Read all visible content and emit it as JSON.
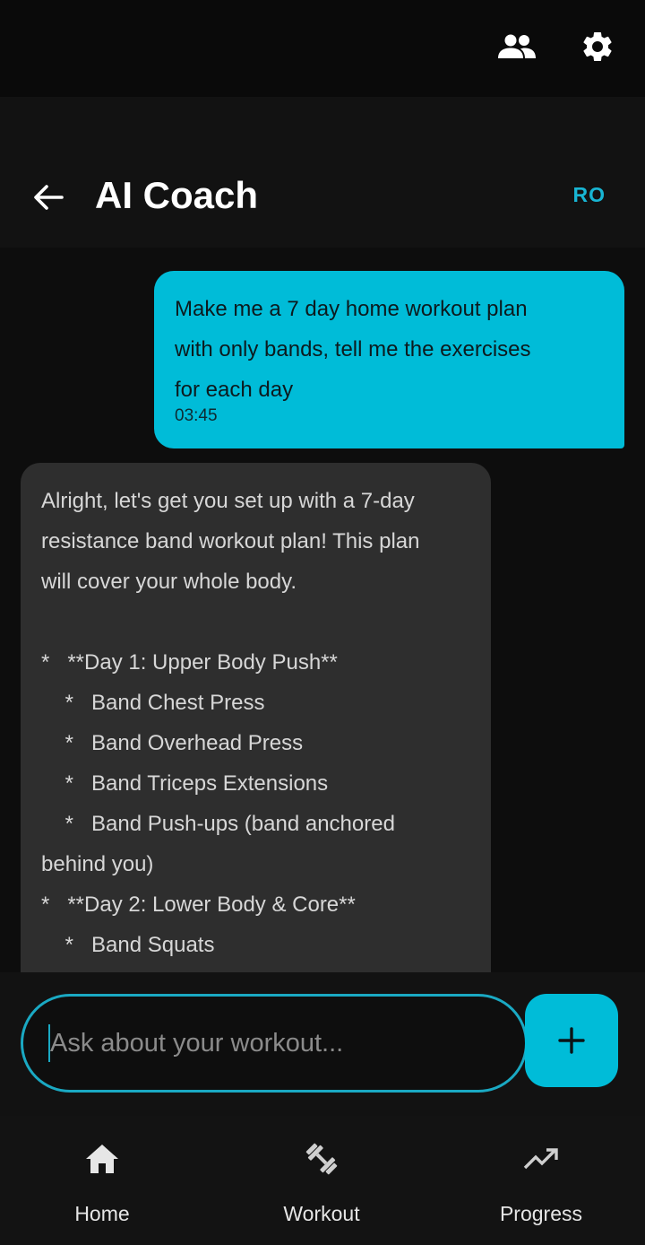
{
  "topbar": {
    "icons": [
      "people-icon",
      "gear-icon"
    ]
  },
  "header": {
    "title": "AI Coach",
    "avatar_initials": "RO"
  },
  "chat": {
    "messages": [
      {
        "role": "user",
        "text": "Make me a 7 day home workout plan\nwith only bands, tell me the exercises\nfor each day",
        "time": "03:45"
      },
      {
        "role": "assistant",
        "text": "Alright, let's get you set up with a 7-day\nresistance band workout plan! This plan\nwill cover your whole body.\n\n*   **Day 1: Upper Body Push**\n    *   Band Chest Press\n    *   Band Overhead Press\n    *   Band Triceps Extensions\n    *   Band Push-ups (band anchored\nbehind you)\n*   **Day 2: Lower Body & Core**\n    *   Band Squats\n    *   Band Glute Bridges"
      }
    ]
  },
  "composer": {
    "placeholder": "Ask about your workout...",
    "value": "",
    "send_icon": "plus-icon"
  },
  "nav": {
    "items": [
      {
        "label": "Home",
        "icon": "home-icon"
      },
      {
        "label": "Workout",
        "icon": "dumbbell-icon"
      },
      {
        "label": "Progress",
        "icon": "trending-up-icon"
      }
    ]
  },
  "colors": {
    "accent": "#00bcd8",
    "background": "#101010",
    "assistant_bubble": "#2e2e2e"
  }
}
